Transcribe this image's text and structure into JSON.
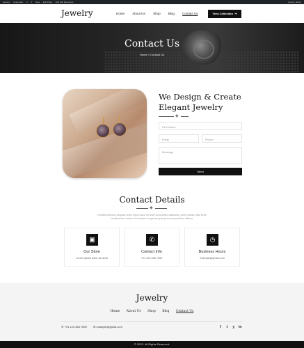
{
  "admin_bar": {
    "items": [
      "Jewelry",
      "Customize",
      "2",
      "0",
      "New",
      "Edit Page",
      "Edit with Elementor"
    ],
    "user": "Howdy, admin"
  },
  "header": {
    "logo": "Jewelry",
    "nav": [
      "Home",
      "About Us",
      "Shop",
      "Blog",
      "Contact Us"
    ],
    "active_nav": "Contact Us",
    "cta_label": "View Collection",
    "cta_icon": "arrow-right-icon"
  },
  "hero": {
    "title": "Contact Us",
    "breadcrumb": "Home » Contact Us"
  },
  "contact_form": {
    "heading_line1": "We Design & Create",
    "heading_line2": "Elegant Jewelry",
    "first_name_placeholder": "First Name",
    "email_placeholder": "Email",
    "phone_placeholder": "Phone",
    "message_placeholder": "Message",
    "send_label": "Send"
  },
  "contact_details": {
    "title": "Contact Details",
    "description": "Facilisis interdum aliquam lorem ipsum dolor sit amet consectetur adipiscing. Amet massa vitae tortor condimentum lacinia. Ut tristique et egestas quis ipsum suspendisse ultrices.",
    "cards": [
      {
        "icon": "map-icon",
        "title": "Our Store",
        "text": "Lorem ipsum dolor sit amet"
      },
      {
        "icon": "phone-icon",
        "title": "Contact Info",
        "text": "+91 123 456 7890"
      },
      {
        "icon": "clock-icon",
        "title": "Business Hours",
        "text": "example@gmail.com"
      }
    ]
  },
  "footer": {
    "logo": "Jewelry",
    "nav": [
      "Home",
      "About Us",
      "Shop",
      "Blog",
      "Contact Us"
    ],
    "active_nav": "Contact Us",
    "phone": "+91 123 456 7890",
    "email": "example@gmail.com",
    "social": [
      "f",
      "t",
      "y",
      "in"
    ],
    "copyright": "© 2023. All Rights Reserved."
  },
  "colors": {
    "dark": "#111111",
    "footer_bg": "#f4f4f4",
    "admin_bg": "#1d2327"
  }
}
